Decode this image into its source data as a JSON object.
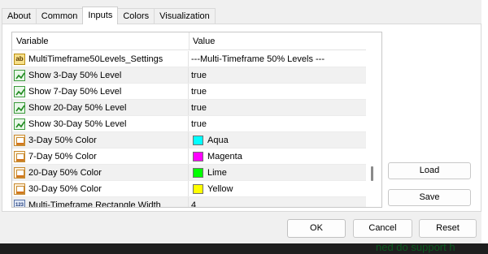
{
  "tabs": [
    {
      "label": "About"
    },
    {
      "label": "Common"
    },
    {
      "label": "Inputs",
      "active": true
    },
    {
      "label": "Colors"
    },
    {
      "label": "Visualization"
    }
  ],
  "grid": {
    "col_variable": "Variable",
    "col_value": "Value",
    "rows": [
      {
        "icon": "string-icon",
        "variable": "MultiTimeframe50Levels_Settings",
        "value": "---Multi-Timeframe 50% Levels ---"
      },
      {
        "icon": "bool-icon",
        "variable": "Show 3-Day 50% Level",
        "value": "true"
      },
      {
        "icon": "bool-icon",
        "variable": "Show 7-Day 50% Level",
        "value": "true"
      },
      {
        "icon": "bool-icon",
        "variable": "Show 20-Day 50% Level",
        "value": "true"
      },
      {
        "icon": "bool-icon",
        "variable": "Show 30-Day 50% Level",
        "value": "true"
      },
      {
        "icon": "color-icon",
        "variable": "3-Day 50% Color",
        "value": "Aqua",
        "swatch": "#00ffff"
      },
      {
        "icon": "color-icon",
        "variable": "7-Day 50% Color",
        "value": "Magenta",
        "swatch": "#ff00ff"
      },
      {
        "icon": "color-icon",
        "variable": "20-Day 50% Color",
        "value": "Lime",
        "swatch": "#00ff00"
      },
      {
        "icon": "color-icon",
        "variable": "30-Day 50% Color",
        "value": "Yellow",
        "swatch": "#ffff00"
      },
      {
        "icon": "number-icon",
        "variable": "Multi-Timeframe Rectangle Width",
        "value": "4"
      }
    ]
  },
  "buttons": {
    "load": "Load",
    "save": "Save",
    "ok": "OK",
    "cancel": "Cancel",
    "reset": "Reset"
  },
  "background": {
    "ghost_text": "ned do support h"
  }
}
